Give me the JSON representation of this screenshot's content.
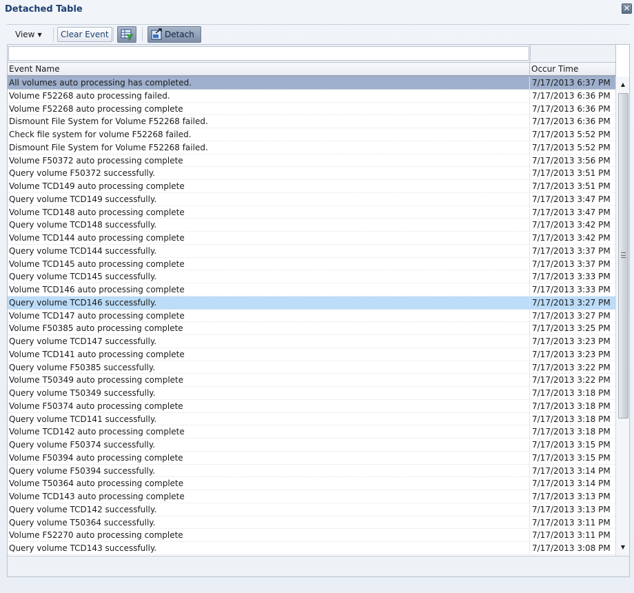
{
  "window": {
    "title": "Detached Table",
    "close_icon": "close-icon"
  },
  "toolbar": {
    "view_label": "View",
    "clear_event_label": "Clear Event",
    "filter_icon": "query-by-example-filter-icon",
    "detach_label": "Detach",
    "detach_icon": "detach-icon"
  },
  "table": {
    "filter": {
      "name_value": "",
      "time_value": ""
    },
    "columns": [
      "Event Name",
      "Occur Time"
    ],
    "selected_row": 0,
    "hover_row": 17,
    "scroll_position_percent": 0,
    "rows": [
      {
        "name": "All volumes auto processing has completed.",
        "time": "7/17/2013 6:37 PM"
      },
      {
        "name": "Volume F52268 auto processing failed.",
        "time": "7/17/2013 6:36 PM"
      },
      {
        "name": "Volume F52268 auto processing complete",
        "time": "7/17/2013 6:36 PM"
      },
      {
        "name": "Dismount File System for Volume F52268 failed.",
        "time": "7/17/2013 6:36 PM"
      },
      {
        "name": "Check file system for volume F52268 failed.",
        "time": "7/17/2013 5:52 PM"
      },
      {
        "name": "Dismount File System for Volume F52268 failed.",
        "time": "7/17/2013 5:52 PM"
      },
      {
        "name": "Volume F50372 auto processing complete",
        "time": "7/17/2013 3:56 PM"
      },
      {
        "name": "Query volume F50372 successfully.",
        "time": "7/17/2013 3:51 PM"
      },
      {
        "name": "Volume TCD149 auto processing complete",
        "time": "7/17/2013 3:51 PM"
      },
      {
        "name": "Query volume TCD149 successfully.",
        "time": "7/17/2013 3:47 PM"
      },
      {
        "name": "Volume TCD148 auto processing complete",
        "time": "7/17/2013 3:47 PM"
      },
      {
        "name": "Query volume TCD148 successfully.",
        "time": "7/17/2013 3:42 PM"
      },
      {
        "name": "Volume TCD144 auto processing complete",
        "time": "7/17/2013 3:42 PM"
      },
      {
        "name": "Query volume TCD144 successfully.",
        "time": "7/17/2013 3:37 PM"
      },
      {
        "name": "Volume TCD145 auto processing complete",
        "time": "7/17/2013 3:37 PM"
      },
      {
        "name": "Query volume TCD145 successfully.",
        "time": "7/17/2013 3:33 PM"
      },
      {
        "name": "Volume TCD146 auto processing complete",
        "time": "7/17/2013 3:33 PM"
      },
      {
        "name": "Query volume TCD146 successfully.",
        "time": "7/17/2013 3:27 PM"
      },
      {
        "name": "Volume TCD147 auto processing complete",
        "time": "7/17/2013 3:27 PM"
      },
      {
        "name": "Volume F50385 auto processing complete",
        "time": "7/17/2013 3:25 PM"
      },
      {
        "name": "Query volume TCD147 successfully.",
        "time": "7/17/2013 3:23 PM"
      },
      {
        "name": "Volume TCD141 auto processing complete",
        "time": "7/17/2013 3:23 PM"
      },
      {
        "name": "Query volume F50385 successfully.",
        "time": "7/17/2013 3:22 PM"
      },
      {
        "name": "Volume T50349 auto processing complete",
        "time": "7/17/2013 3:22 PM"
      },
      {
        "name": "Query volume T50349 successfully.",
        "time": "7/17/2013 3:18 PM"
      },
      {
        "name": "Volume F50374 auto processing complete",
        "time": "7/17/2013 3:18 PM"
      },
      {
        "name": "Query volume TCD141 successfully.",
        "time": "7/17/2013 3:18 PM"
      },
      {
        "name": "Volume TCD142 auto processing complete",
        "time": "7/17/2013 3:18 PM"
      },
      {
        "name": "Query volume F50374 successfully.",
        "time": "7/17/2013 3:15 PM"
      },
      {
        "name": "Volume F50394 auto processing complete",
        "time": "7/17/2013 3:15 PM"
      },
      {
        "name": "Query volume F50394 successfully.",
        "time": "7/17/2013 3:14 PM"
      },
      {
        "name": "Volume T50364 auto processing complete",
        "time": "7/17/2013 3:14 PM"
      },
      {
        "name": "Volume TCD143 auto processing complete",
        "time": "7/17/2013 3:13 PM"
      },
      {
        "name": "Query volume TCD142 successfully.",
        "time": "7/17/2013 3:13 PM"
      },
      {
        "name": "Query volume T50364 successfully.",
        "time": "7/17/2013 3:11 PM"
      },
      {
        "name": "Volume F52270 auto processing complete",
        "time": "7/17/2013 3:11 PM"
      },
      {
        "name": "Query volume TCD143 successfully.",
        "time": "7/17/2013 3:08 PM"
      }
    ]
  },
  "scrollbar": {
    "up_icon": "scroll-up-arrow-icon",
    "down_icon": "scroll-down-arrow-icon"
  }
}
